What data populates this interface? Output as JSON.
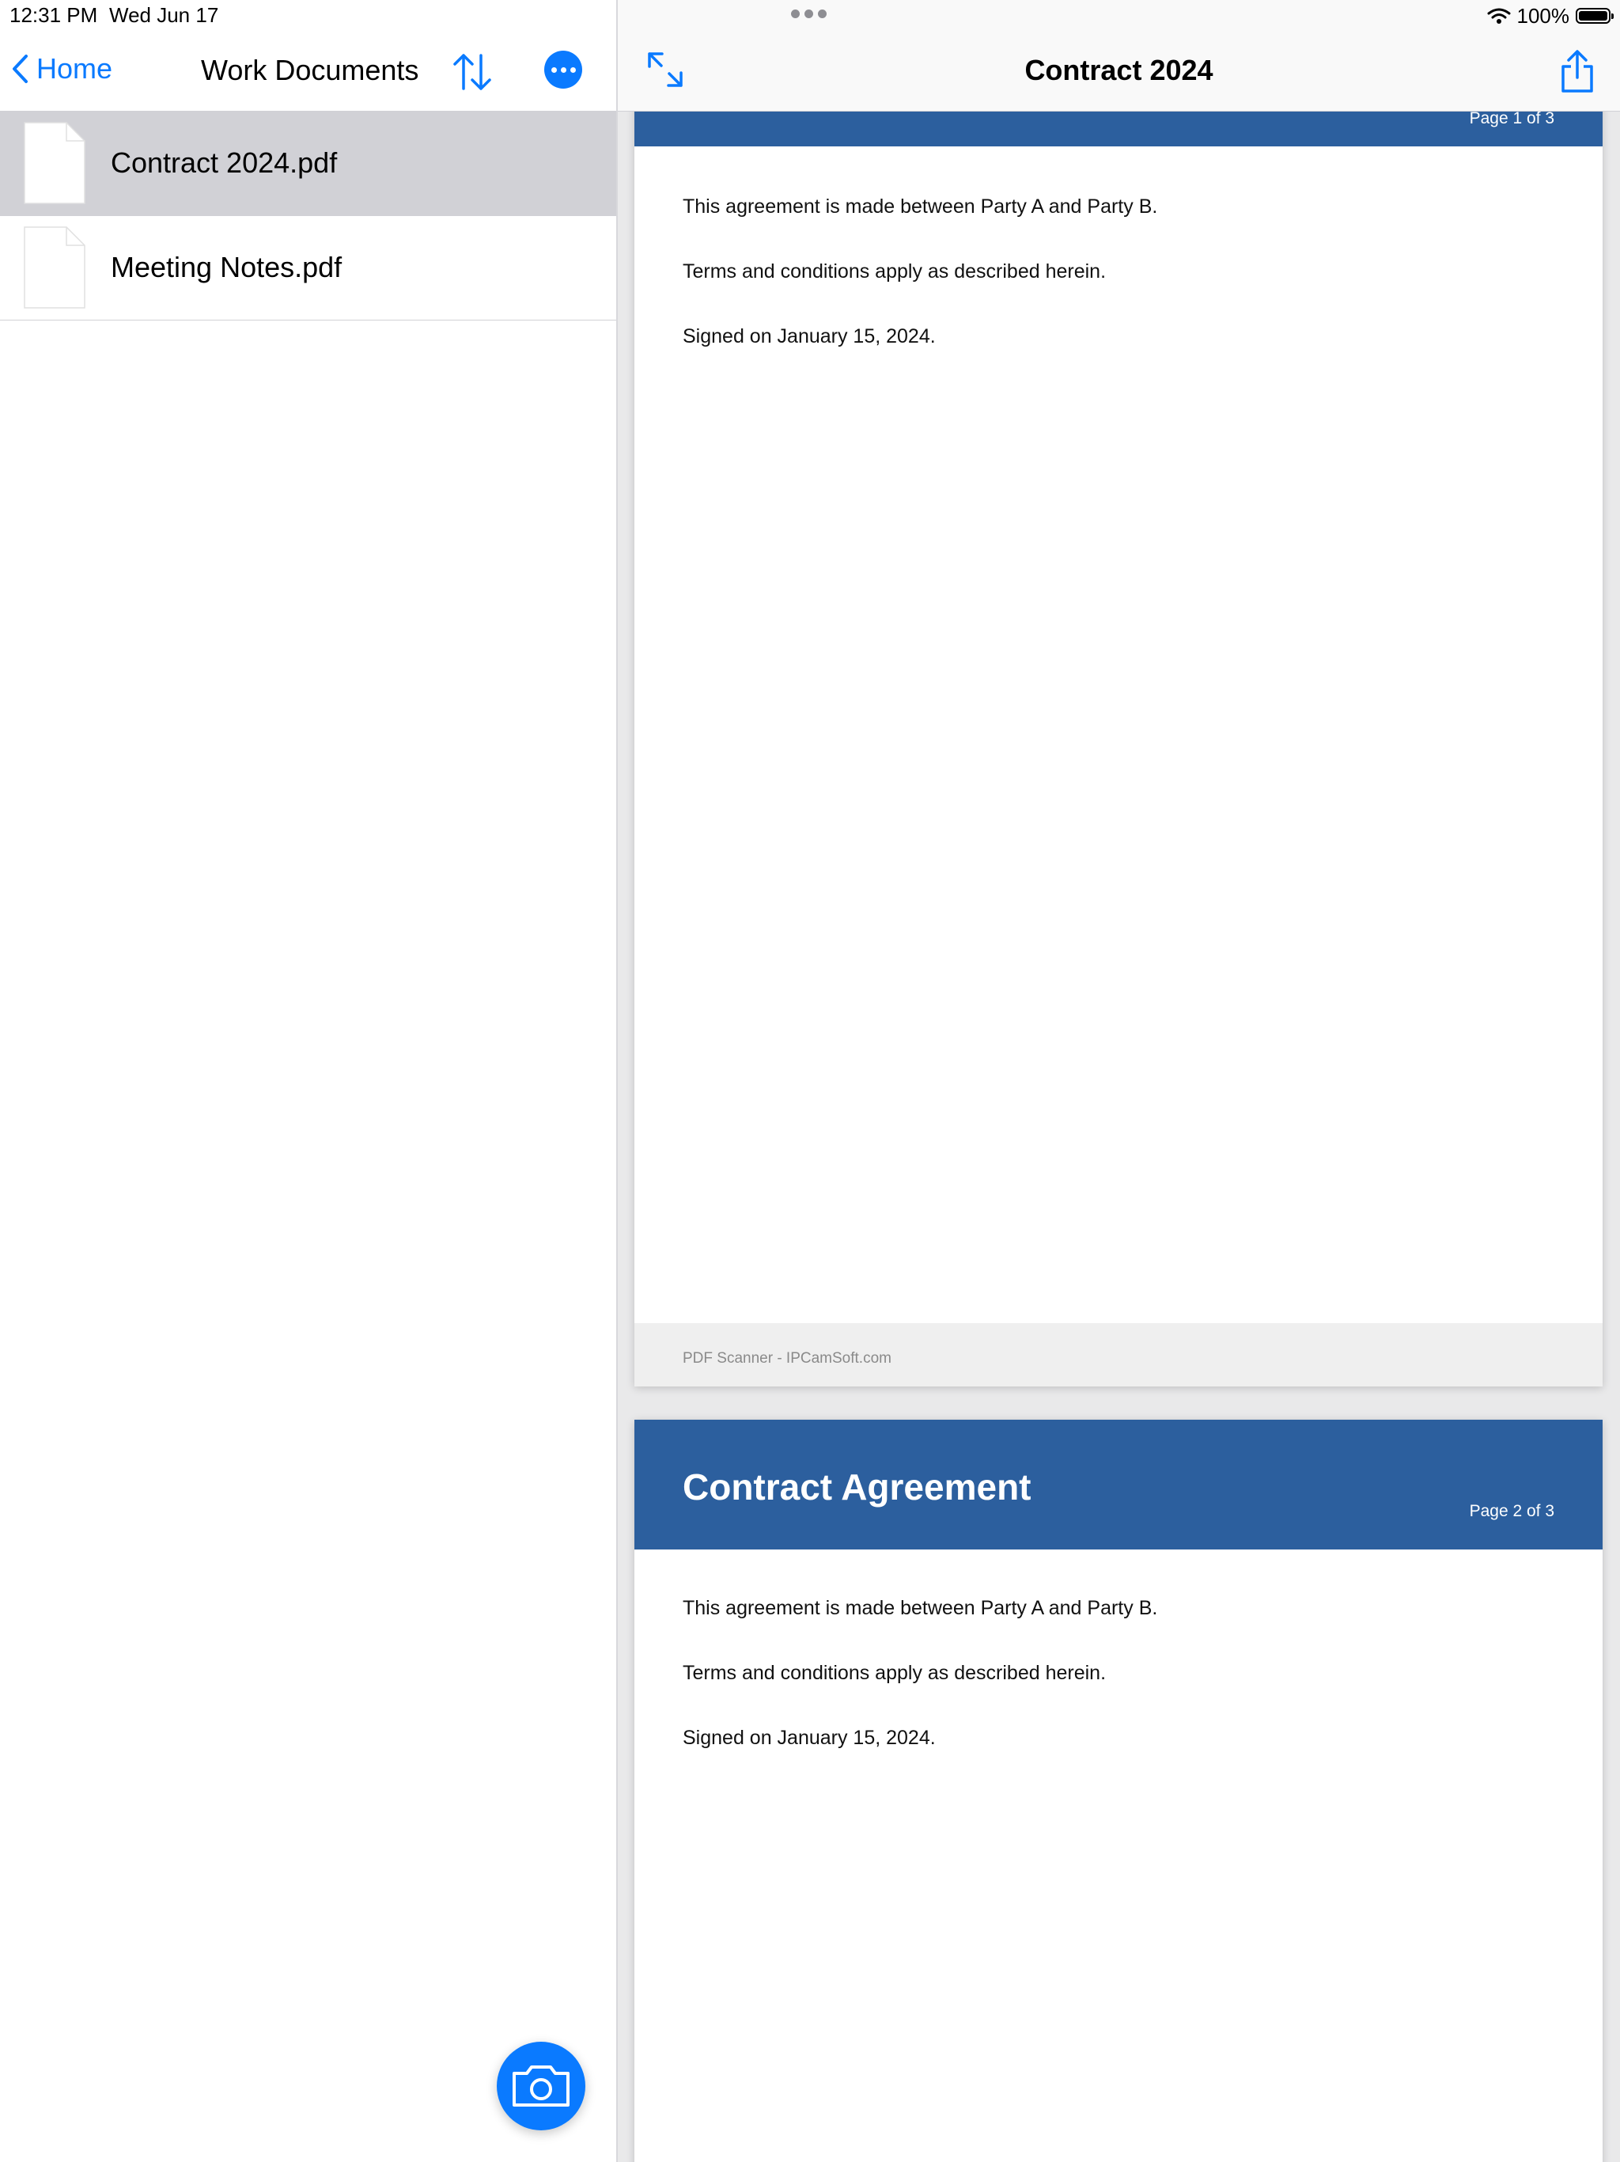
{
  "status_bar": {
    "time": "12:31 PM",
    "date": "Wed Jun 17",
    "battery": "100%"
  },
  "left_pane": {
    "back_label": "Home",
    "title": "Work Documents",
    "files": [
      {
        "name": "Contract 2024.pdf",
        "selected": true
      },
      {
        "name": "Meeting Notes.pdf",
        "selected": false
      }
    ]
  },
  "right_pane": {
    "title": "Contract 2024",
    "pages": [
      {
        "banner_title": "",
        "page_label": "Page 1 of 3",
        "lines": [
          "This agreement is made between Party A and Party B.",
          "Terms and conditions apply as described herein.",
          "Signed on January 15, 2024."
        ],
        "footer": "PDF Scanner - IPCamSoft.com"
      },
      {
        "banner_title": "Contract Agreement",
        "page_label": "Page 2 of 3",
        "lines": [
          "This agreement is made between Party A and Party B.",
          "Terms and conditions apply as described herein.",
          "Signed on January 15, 2024."
        ]
      }
    ]
  },
  "colors": {
    "accent": "#0a7aff",
    "banner": "#2c5f9e",
    "selected_row": "#d1d1d6"
  },
  "icons": [
    "chevron-left-icon",
    "sort-icon",
    "more-icon",
    "file-icon",
    "camera-icon",
    "expand-icon",
    "share-icon",
    "wifi-icon",
    "battery-icon"
  ]
}
